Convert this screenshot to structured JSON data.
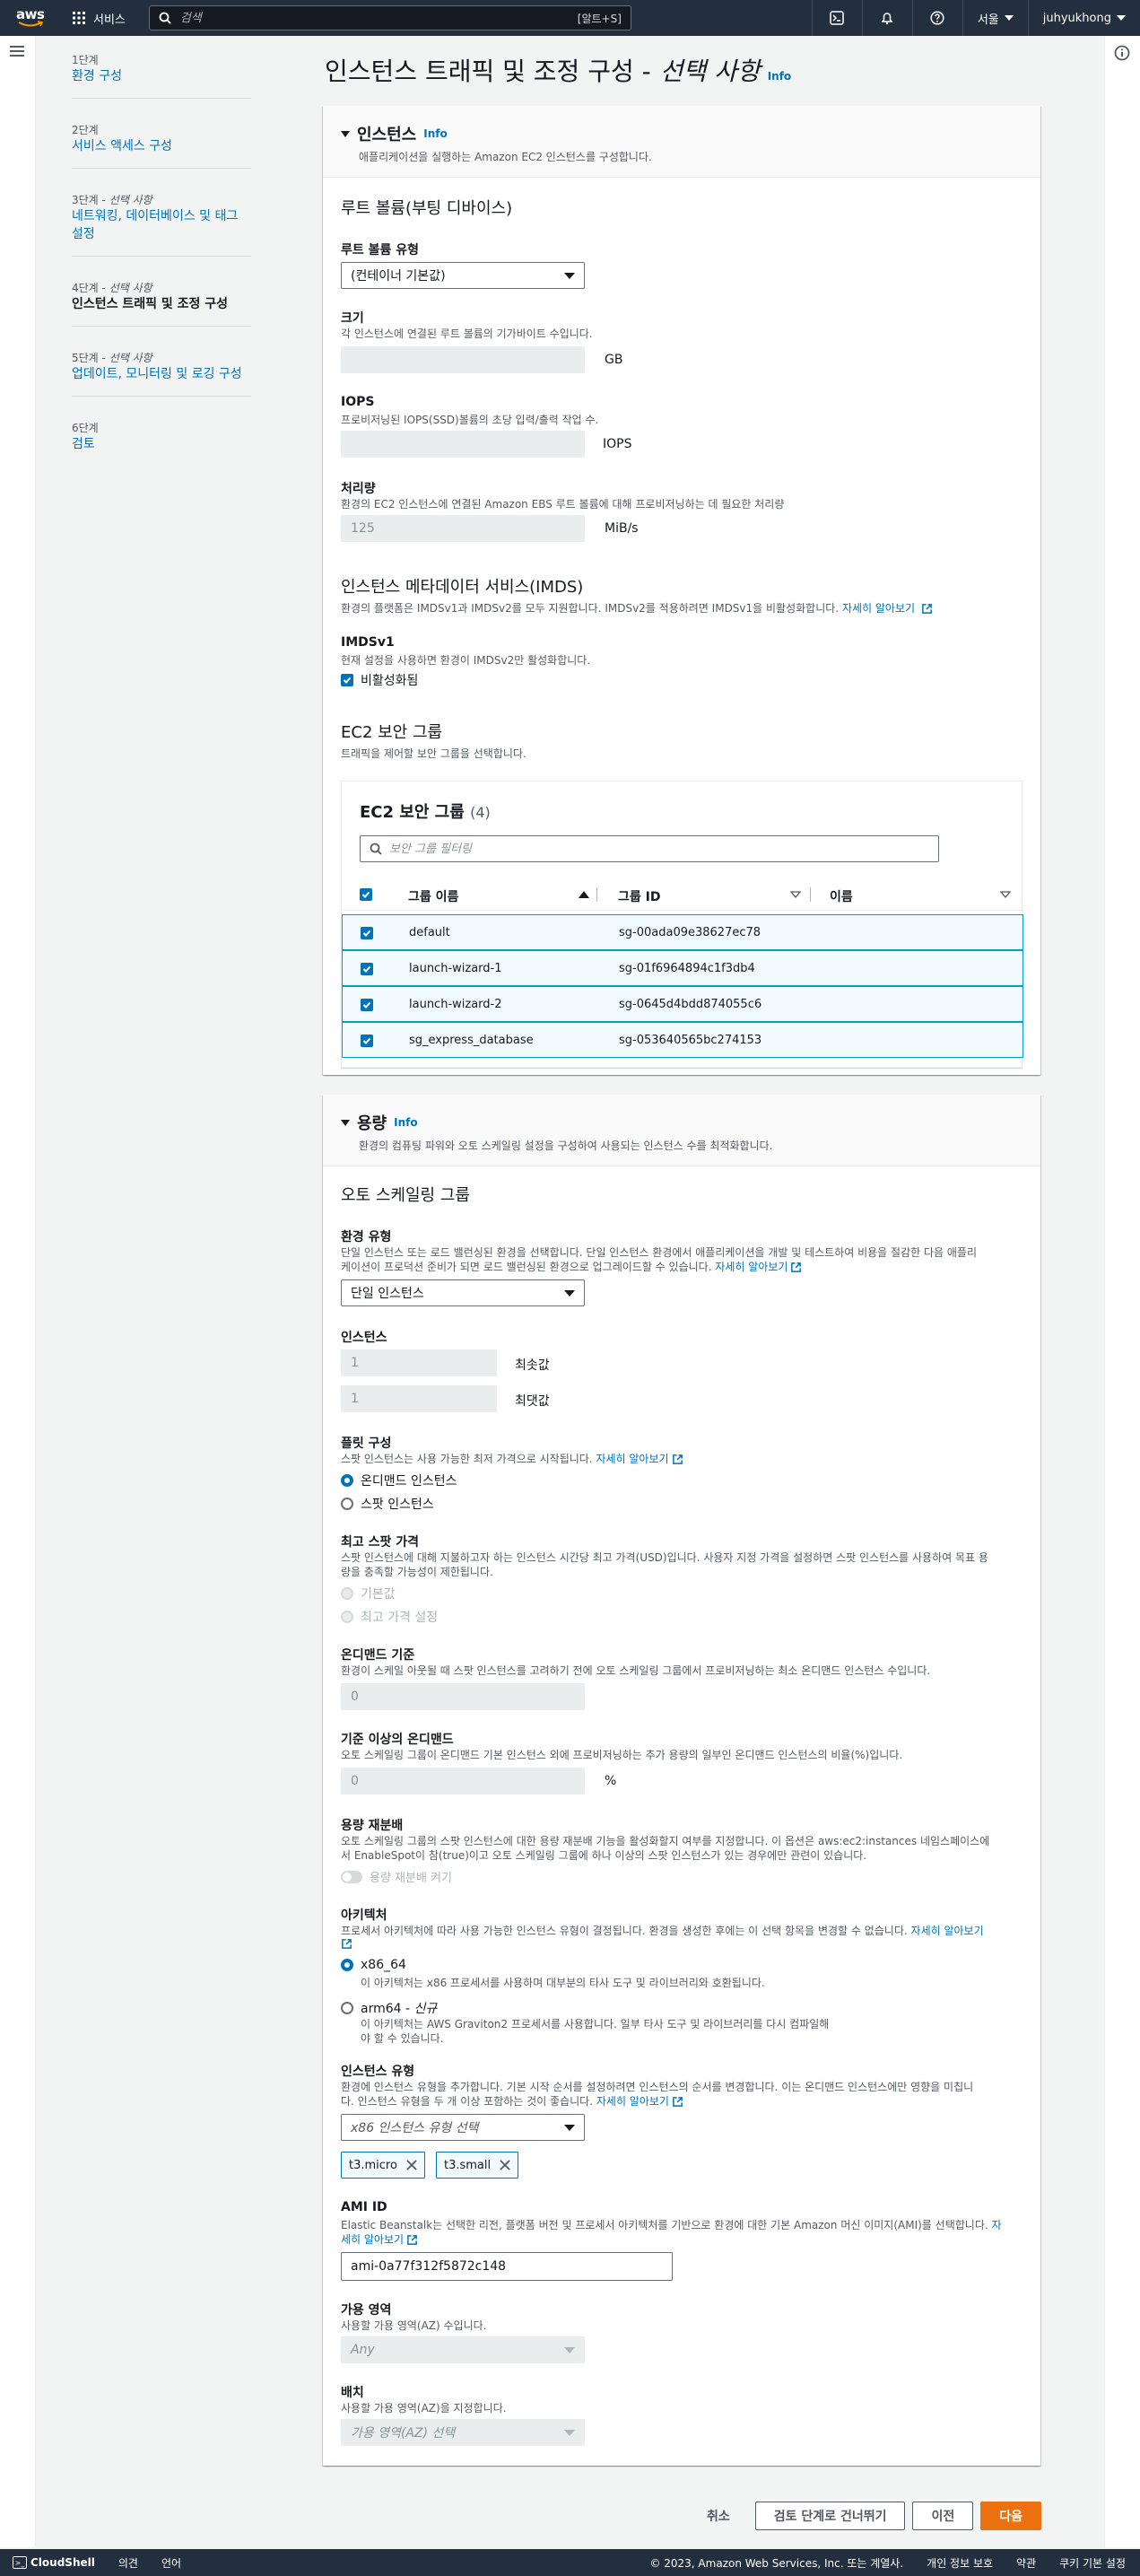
{
  "topnav": {
    "logo": "aws",
    "services_label": "서비스",
    "search_placeholder": "검색",
    "search_shortcut": "[알트+S]",
    "region": "서울",
    "user": "juhyukhong"
  },
  "steps": [
    {
      "num": "1단계",
      "optional": "",
      "title": "환경 구성"
    },
    {
      "num": "2단계",
      "optional": "",
      "title": "서비스 액세스 구성"
    },
    {
      "num": "3단계 -",
      "optional": "선택 사항",
      "title": "네트워킹, 데이터베이스 및 태그 설정"
    },
    {
      "num": "4단계 -",
      "optional": "선택 사항",
      "title": "인스턴스 트래픽 및 조정 구성"
    },
    {
      "num": "5단계 -",
      "optional": "선택 사항",
      "title": "업데이트, 모니터링 및 로깅 구성"
    },
    {
      "num": "6단계",
      "optional": "",
      "title": "검토"
    }
  ],
  "page": {
    "title": "인스턴스 트래픽 및 조정 구성 -",
    "title_optional": "선택 사항",
    "info": "Info"
  },
  "instances": {
    "header": "인스턴스",
    "info": "Info",
    "desc": "애플리케이션을 실행하는 Amazon EC2 인스턴스를 구성합니다.",
    "root_volume_title": "루트 볼륨(부팅 디바이스)",
    "root_volume_type_label": "루트 볼륨 유형",
    "root_volume_type_value": "(컨테이너 기본값)",
    "size_label": "크기",
    "size_hint": "각 인스턴스에 연결된 루트 볼륨의 기가바이트 수입니다.",
    "size_unit": "GB",
    "iops_label": "IOPS",
    "iops_hint": "프로비저닝된 IOPS(SSD)볼륨의 초당 입력/출력 작업 수.",
    "iops_unit": "IOPS",
    "throughput_label": "처리량",
    "throughput_hint": "환경의 EC2 인스턴스에 연결된 Amazon EBS 루트 볼륨에 대해 프로비저닝하는 데 필요한 처리량",
    "throughput_value": "125",
    "throughput_unit": "MiB/s",
    "imds_title": "인스턴스 메타데이터 서비스(IMDS)",
    "imds_hint": "환경의 플랫폼은 IMDSv1과 IMDSv2를 모두 지원합니다. IMDSv2를 적용하려면 IMDSv1을 비활성화합니다.",
    "imds_link": "자세히 알아보기",
    "imdsv1_label": "IMDSv1",
    "imdsv1_hint": "현재 설정을 사용하면 환경이 IMDSv2만 활성화합니다.",
    "imdsv1_checkbox": "비활성화됨",
    "sg_title": "EC2 보안 그룹",
    "sg_hint": "트래픽을 제어할 보안 그룹을 선택합니다.",
    "sg_table_title": "EC2 보안 그룹",
    "sg_count": "(4)",
    "sg_filter_placeholder": "보안 그룹 필터링",
    "sg_columns": [
      "그룹 이름",
      "그룹 ID",
      "이름"
    ],
    "sg_rows": [
      {
        "name": "default",
        "id": "sg-00ada09e38627ec78"
      },
      {
        "name": "launch-wizard-1",
        "id": "sg-01f6964894c1f3db4"
      },
      {
        "name": "launch-wizard-2",
        "id": "sg-0645d4bdd874055c6"
      },
      {
        "name": "sg_express_database",
        "id": "sg-053640565bc274153"
      }
    ]
  },
  "capacity": {
    "header": "용량",
    "info": "Info",
    "desc": "환경의 컴퓨팅 파워와 오토 스케일링 설정을 구성하여 사용되는 인스턴스 수를 최적화합니다.",
    "asg_title": "오토 스케일링 그룹",
    "env_type_label": "환경 유형",
    "env_type_hint_1": "단일 인스턴스 또는 로드 밸런싱된 환경을 선택합니다. 단일 인스턴스 환경에서 애플리케이션을 개발 및 테스트하여 비용을 절감한 다음 애플리",
    "env_type_hint_2": "케이션이 프로덕션 준비가 되면 로드 밸런싱된 환경으로 업그레이드할 수 있습니다.",
    "env_type_link": "자세히 알아보기",
    "env_type_value": "단일 인스턴스",
    "instances_label": "인스턴스",
    "min_value": "1",
    "min_label": "최솟값",
    "max_value": "1",
    "max_label": "최댓값",
    "fleet_label": "플릿 구성",
    "fleet_hint": "스팟 인스턴스는 사용 가능한 최저 가격으로 시작됩니다.",
    "fleet_link": "자세히 알아보기",
    "fleet_on_demand": "온디맨드 인스턴스",
    "fleet_spot": "스팟 인스턴스",
    "max_spot_label": "최고 스팟 가격",
    "max_spot_hint_1": "스팟 인스턴스에 대해 지불하고자 하는 인스턴스 시간당 최고 가격(USD)입니다. 사용자 지정 가격을 설정하면 스팟 인스턴스를 사용하여 목표 용",
    "max_spot_hint_2": "량을 충족할 가능성이 제한됩니다.",
    "max_spot_default": "기본값",
    "max_spot_custom": "최고 가격 설정",
    "od_base_label": "온디맨드 기준",
    "od_base_hint": "환경이 스케일 아웃될 때 스팟 인스턴스를 고려하기 전에 오토 스케일링 그룹에서 프로비저닝하는 최소 온디맨드 인스턴스 수입니다.",
    "od_base_value": "0",
    "od_above_label": "기준 이상의 온디맨드",
    "od_above_hint": "오토 스케일링 그룹이 온디맨드 기본 인스턴스 외에 프로비저닝하는 추가 용량의 일부인 온디맨드 인스턴스의 비율(%)입니다.",
    "od_above_value": "0",
    "od_above_unit": "%",
    "rebalance_label": "용량 재분배",
    "rebalance_hint_1": "오토 스케일링 그룹의 스팟 인스턴스에 대한 용량 재분배 기능을 활성화할지 여부를 지정합니다. 이 옵션은 aws:ec2:instances 네임스페이스에",
    "rebalance_hint_2": "서 EnableSpot이 참(true)이고 오토 스케일링 그룹에 하나 이상의 스팟 인스턴스가 있는 경우에만 관련이 있습니다.",
    "rebalance_toggle": "용량 재분배 켜기",
    "arch_label": "아키텍처",
    "arch_hint": "프로세서 아키텍처에 따라 사용 가능한 인스턴스 유형이 결정됩니다. 환경을 생성한 후에는 이 선택 항목을 변경할 수 없습니다.",
    "arch_link": "자세히 알아보기",
    "arch_x86": "x86_64",
    "arch_x86_hint": "이 아키텍처는 x86 프로세서를 사용하며 대부분의 타사 도구 및 라이브러리와 호환됩니다.",
    "arch_arm": "arm64 -",
    "arch_arm_new": "신규",
    "arch_arm_hint_1": "이 아키텍처는 AWS Graviton2 프로세서를 사용합니다. 일부 타사 도구 및 라이브러리를 다시 컴파일해",
    "arch_arm_hint_2": "야 할 수 있습니다.",
    "itype_label": "인스턴스 유형",
    "itype_hint_1": "환경에 인스턴스 유형을 추가합니다. 기본 시작 순서를 설정하려면 인스턴스의 순서를 변경합니다. 이는 온디맨드 인스턴스에만 영향을 미칩니",
    "itype_hint_2": "다. 인스턴스 유형을 두 개 이상 포함하는 것이 좋습니다.",
    "itype_link": "자세히 알아보기",
    "itype_select": "x86 인스턴스 유형 선택",
    "itype_tokens": [
      "t3.micro",
      "t3.small"
    ],
    "ami_label": "AMI ID",
    "ami_hint_1": "Elastic Beanstalk는 선택한 리전, 플랫폼 버전 및 프로세서 아키텍처를 기반으로 환경에 대한 기본 Amazon 머신 이미지(AMI)를 선택합니다.",
    "ami_link_1": "자",
    "ami_link_2": "세히 알아보기",
    "ami_value": "ami-0a77f312f5872c148",
    "az_label": "가용 영역",
    "az_hint": "사용할 가용 영역(AZ) 수입니다.",
    "az_value": "Any",
    "placement_label": "배치",
    "placement_hint": "사용할 가용 영역(AZ)을 지정합니다.",
    "placement_value": "가용 영역(AZ) 선택"
  },
  "actions": {
    "cancel": "취소",
    "skip": "검토 단계로 건너뛰기",
    "prev": "이전",
    "next": "다음"
  },
  "footer": {
    "cloudshell": "CloudShell",
    "feedback": "의견",
    "language": "언어",
    "copyright": "© 2023, Amazon Web Services, Inc. 또는 계열사.",
    "privacy": "개인 정보 보호",
    "terms": "약관",
    "cookies": "쿠키 기본 설정"
  },
  "colors": {
    "nav_bg": "#232f3e",
    "link": "#0073bb",
    "primary_button": "#ec7211",
    "selected_row_border": "#00a1c9",
    "selected_row_bg": "#f1faff"
  }
}
